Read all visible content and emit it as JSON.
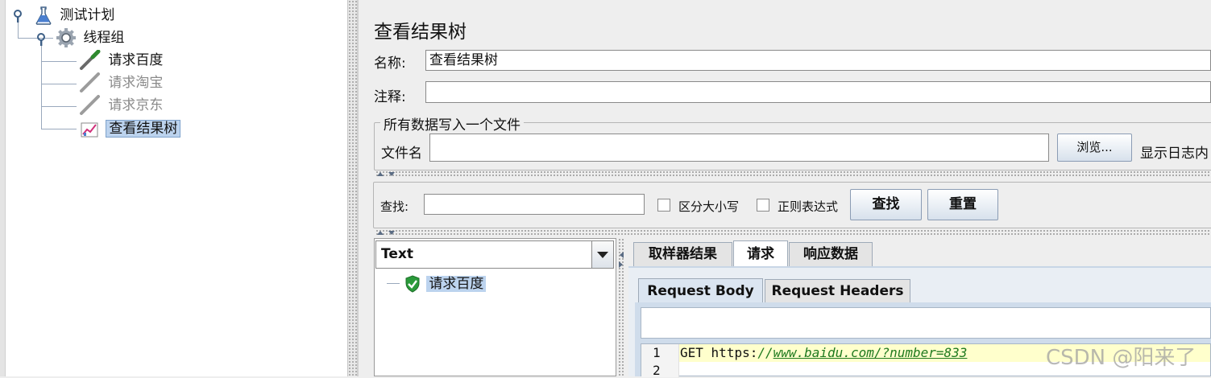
{
  "tree": {
    "nodes": [
      {
        "label": "测试计划",
        "icon": "flask-icon"
      },
      {
        "label": "线程组",
        "icon": "gear-icon"
      },
      {
        "label": "请求百度",
        "icon": "pipette-icon",
        "state": "enabled"
      },
      {
        "label": "请求淘宝",
        "icon": "pipette-icon",
        "state": "disabled"
      },
      {
        "label": "请求京东",
        "icon": "pipette-icon",
        "state": "disabled"
      },
      {
        "label": "查看结果树",
        "icon": "chart-icon",
        "state": "selected"
      }
    ]
  },
  "panel": {
    "title": "查看结果树",
    "name_label": "名称:",
    "name_value": "查看结果树",
    "comment_label": "注释:",
    "comment_value": "",
    "file_group_title": "所有数据写入一个文件",
    "filename_label": "文件名",
    "filename_value": "",
    "browse_button": "浏览...",
    "log_label": "显示日志内"
  },
  "search": {
    "label": "查找:",
    "value": "",
    "case_sensitive_label": "区分大小写",
    "regex_label": "正则表达式",
    "find_button": "查找",
    "reset_button": "重置"
  },
  "results": {
    "renderer_selected": "Text",
    "items": [
      {
        "label": "请求百度",
        "status": "success"
      }
    ]
  },
  "tabs": {
    "main": [
      {
        "label": "取样器结果",
        "selected": false
      },
      {
        "label": "请求",
        "selected": true
      },
      {
        "label": "响应数据",
        "selected": false
      }
    ],
    "sub": [
      {
        "label": "Request Body",
        "selected": true
      },
      {
        "label": "Request Headers",
        "selected": false
      }
    ]
  },
  "request_body": {
    "lines": [
      {
        "num": "1",
        "method": "GET",
        "scheme": "https:",
        "sep": "//",
        "url": "www.baidu.com/?number=833"
      },
      {
        "num": "2"
      }
    ]
  },
  "watermark": "CSDN @阳来了",
  "colors": {
    "selection": "#bcd3ee",
    "highlight_line": "#ffffcc",
    "url_green": "#1f7a1f"
  }
}
